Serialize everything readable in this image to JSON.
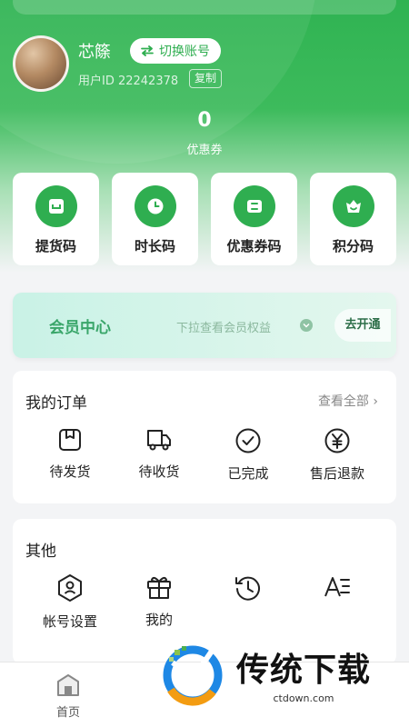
{
  "profile": {
    "username": "芯篨",
    "switch_label": "切换账号",
    "user_id": "用户ID 22242378",
    "copy_label": "复制"
  },
  "coupon": {
    "count": "0",
    "label": "优惠券"
  },
  "codes": [
    {
      "label": "提货码",
      "icon": "pickup-code-icon"
    },
    {
      "label": "时长码",
      "icon": "clock-icon"
    },
    {
      "label": "优惠券码",
      "icon": "ticket-icon"
    },
    {
      "label": "积分码",
      "icon": "points-icon"
    }
  ],
  "member": {
    "title": "会员中心",
    "hint": "下拉查看会员权益",
    "open_label": "去开通"
  },
  "orders": {
    "title": "我的订单",
    "view_all": "查看全部 ›",
    "items": [
      {
        "label": "待发货",
        "icon": "box-icon"
      },
      {
        "label": "待收货",
        "icon": "truck-icon"
      },
      {
        "label": "已完成",
        "icon": "check-circle-icon"
      },
      {
        "label": "售后退款",
        "icon": "yuan-icon"
      }
    ]
  },
  "others": {
    "title": "其他",
    "items": [
      {
        "label": "帐号设置",
        "icon": "account-settings-icon"
      },
      {
        "label": "我的",
        "icon": "gift-icon"
      },
      {
        "label": "",
        "icon": "history-icon"
      },
      {
        "label": "",
        "icon": "font-settings-icon"
      }
    ]
  },
  "tabbar": {
    "home_label": "首页"
  },
  "watermark": {
    "title": "传统下载",
    "url": "ctdown.com"
  },
  "colors": {
    "brand": "#2fae50",
    "member_text": "#3aa66a"
  }
}
